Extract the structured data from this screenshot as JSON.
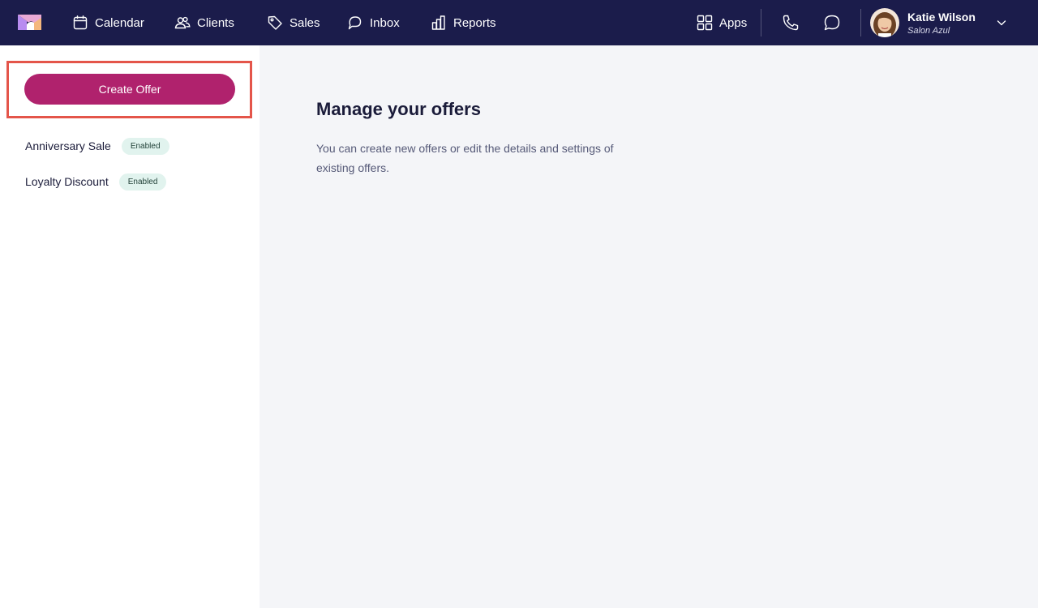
{
  "nav": {
    "items": [
      {
        "label": "Calendar",
        "icon": "calendar-icon"
      },
      {
        "label": "Clients",
        "icon": "users-icon"
      },
      {
        "label": "Sales",
        "icon": "tag-icon"
      },
      {
        "label": "Inbox",
        "icon": "chat-bubble-icon"
      },
      {
        "label": "Reports",
        "icon": "bar-chart-icon"
      }
    ],
    "apps_label": "Apps",
    "user": {
      "name": "Katie Wilson",
      "salon": "Salon Azul"
    }
  },
  "sidebar": {
    "create_label": "Create Offer",
    "offers": [
      {
        "name": "Anniversary Sale",
        "status": "Enabled"
      },
      {
        "name": "Loyalty Discount",
        "status": "Enabled"
      }
    ]
  },
  "main": {
    "title": "Manage your offers",
    "description": "You can create new offers or edit the details and settings of existing offers."
  },
  "colors": {
    "topbar": "#1b1c4b",
    "accent": "#b0226d",
    "highlight": "#e4554a",
    "badge_bg": "#e1f3ee"
  }
}
